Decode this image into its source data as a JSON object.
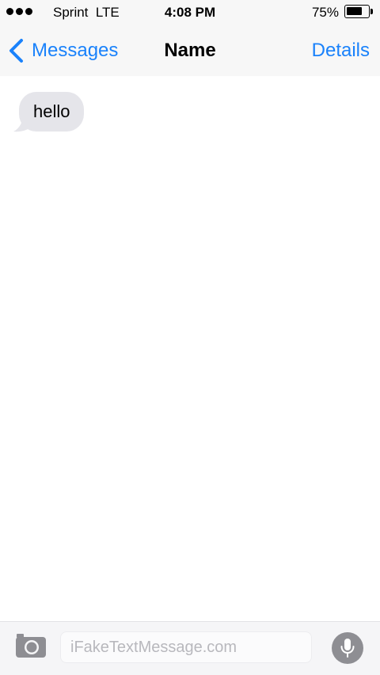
{
  "status_bar": {
    "signal_icon": "signal-dots-icon",
    "signal_dots": 3,
    "carrier": "Sprint  LTE",
    "time": "4:08 PM",
    "battery_percent": "75%",
    "battery_level": 0.75,
    "battery_icon": "battery-icon"
  },
  "nav": {
    "back_icon": "chevron-left-icon",
    "back_label": "Messages",
    "title": "Name",
    "details_label": "Details"
  },
  "conversation": {
    "messages": [
      {
        "direction": "incoming",
        "text": "hello"
      }
    ]
  },
  "input_bar": {
    "camera_icon": "camera-icon",
    "placeholder": "iFakeTextMessage.com",
    "value": "",
    "mic_icon": "microphone-icon"
  },
  "colors": {
    "accent": "#1a82fb",
    "bar_background": "#f7f7f7",
    "incoming_bubble": "#e5e5ea",
    "mic_button": "#8e8e93",
    "camera_icon": "#8e8e93"
  }
}
